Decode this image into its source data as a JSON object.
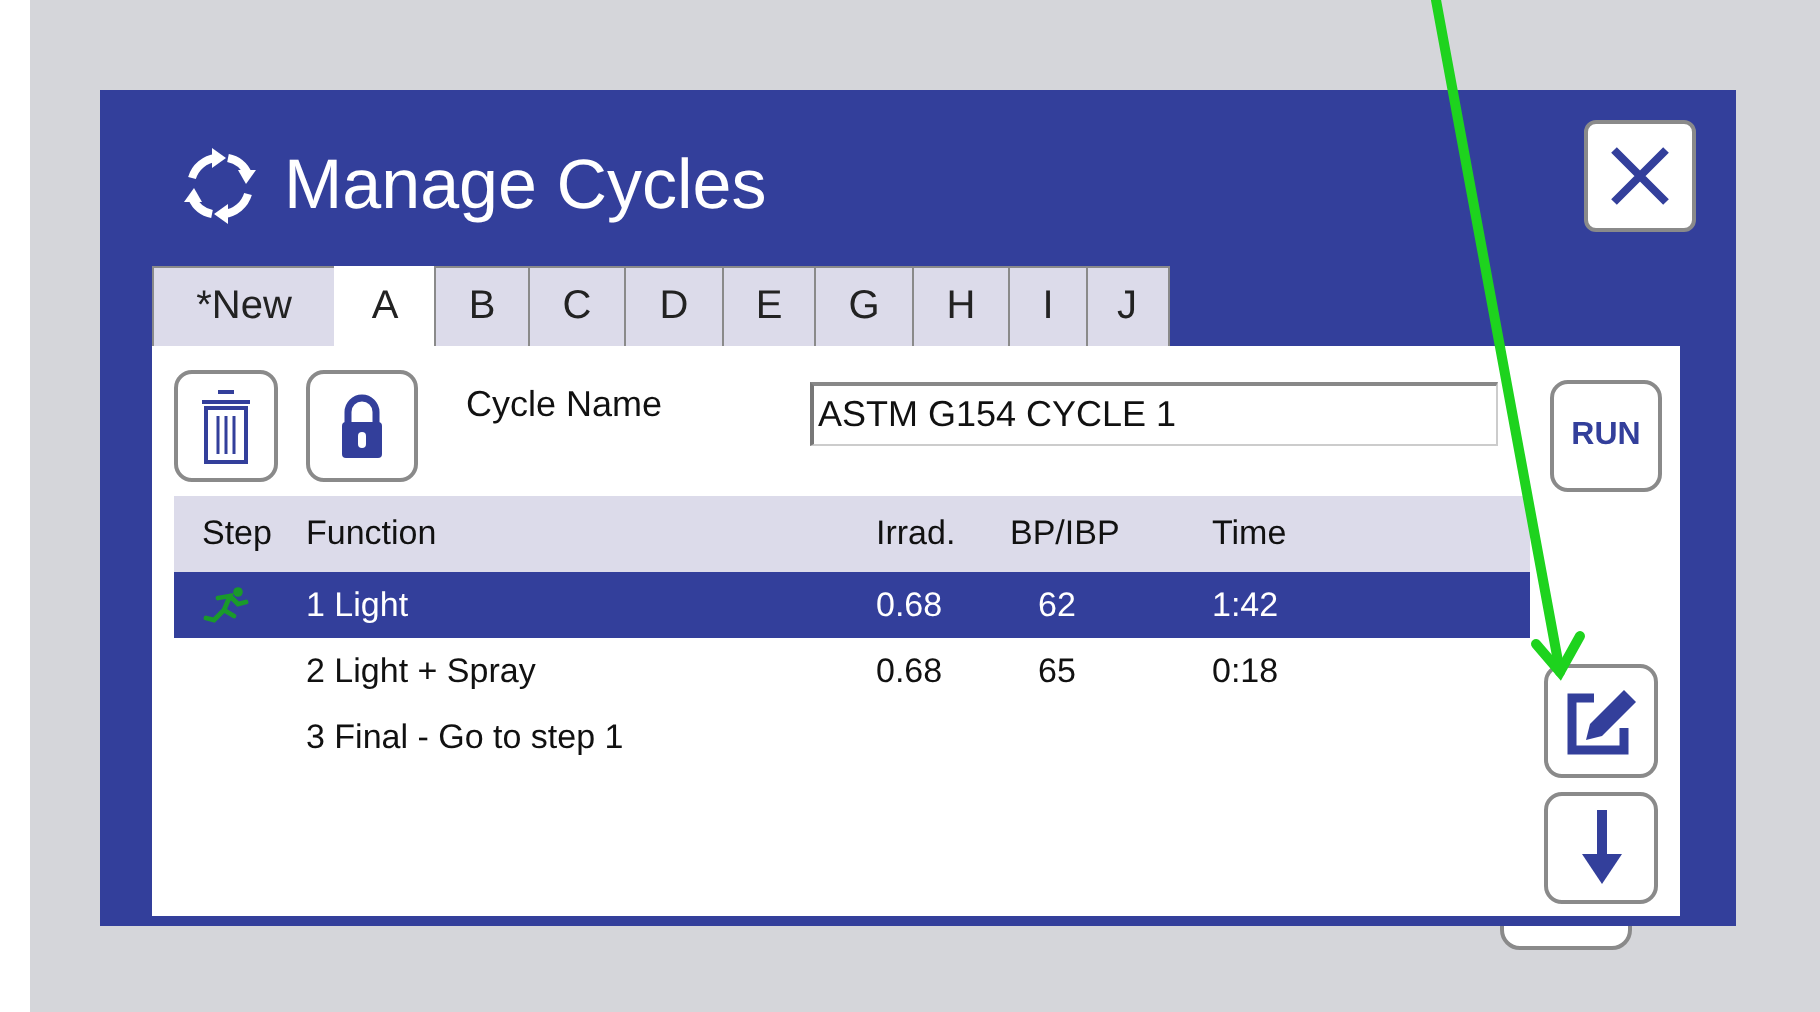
{
  "window": {
    "title": "Manage Cycles"
  },
  "tabs": [
    {
      "label": "*New",
      "selected": false
    },
    {
      "label": "A",
      "selected": true
    },
    {
      "label": "B",
      "selected": false
    },
    {
      "label": "C",
      "selected": false
    },
    {
      "label": "D",
      "selected": false
    },
    {
      "label": "E",
      "selected": false
    },
    {
      "label": "G",
      "selected": false
    },
    {
      "label": "H",
      "selected": false
    },
    {
      "label": "I",
      "selected": false
    },
    {
      "label": "J",
      "selected": false
    }
  ],
  "cycle_name": {
    "label": "Cycle Name",
    "value": "ASTM G154 CYCLE 1"
  },
  "table": {
    "columns": [
      "Step",
      "Function",
      "Irrad.",
      "BP/IBP",
      "Time"
    ],
    "rows": [
      {
        "step": "1 Light",
        "irrad": "0.68",
        "bp": "62",
        "time": "1:42",
        "selected": true,
        "running": true
      },
      {
        "step": "2 Light + Spray",
        "irrad": "0.68",
        "bp": "65",
        "time": "0:18",
        "selected": false,
        "running": false
      },
      {
        "step": "3 Final - Go to step 1",
        "selected": false,
        "running": false
      }
    ]
  },
  "run_button": "RUN"
}
